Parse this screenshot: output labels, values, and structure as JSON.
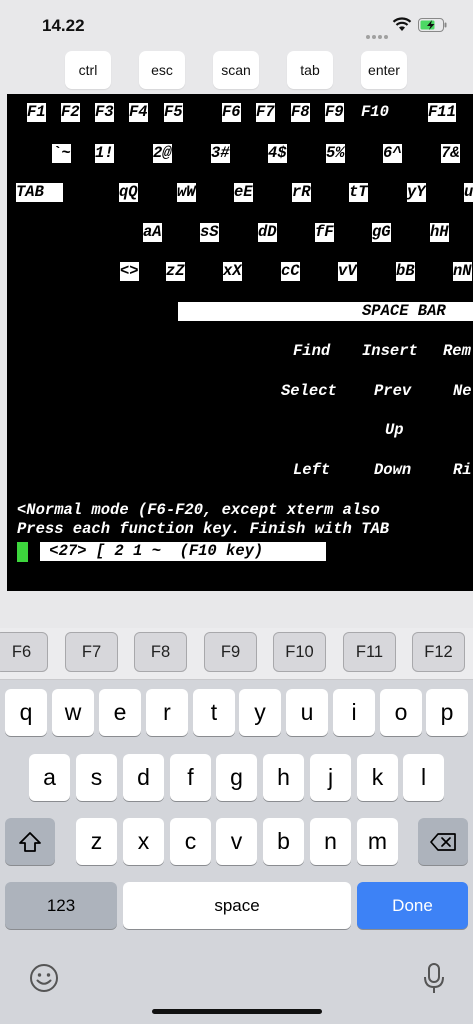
{
  "status_bar": {
    "time": "14.22"
  },
  "control_buttons": [
    "ctrl",
    "esc",
    "scan",
    "tab",
    "enter"
  ],
  "terminal": {
    "fkeys": [
      "F1",
      "F2",
      "F3",
      "F4",
      "F5",
      "F6",
      "F7",
      "F8",
      "F9",
      "F10",
      "F11"
    ],
    "num_keys": [
      "`~",
      "1!",
      "2@",
      "3#",
      "4$",
      "5%",
      "6^",
      "7&"
    ],
    "tab_row": [
      "TAB",
      "qQ",
      "wW",
      "eE",
      "rR",
      "tT",
      "yY",
      "u"
    ],
    "home_row": [
      "aA",
      "sS",
      "dD",
      "fF",
      "gG",
      "hH"
    ],
    "bottom_row": [
      "<>",
      "zZ",
      "xX",
      "cC",
      "vV",
      "bB",
      "nN"
    ],
    "space_bar": "SPACE BAR",
    "nav_row1": [
      "Find",
      "Insert",
      "Rem"
    ],
    "nav_row2": [
      "Select",
      "Prev",
      "Ne"
    ],
    "nav_up": "Up",
    "nav_row4": [
      "Left",
      "Down",
      "Ri"
    ],
    "message_line1": "<Normal mode (F6-F20, except xterm also",
    "message_line2": "Press each function key. Finish with TAB",
    "result_line": " <27> [ 2 1 ~  (F10 key)"
  },
  "keyboard": {
    "function_keys": [
      "F6",
      "F7",
      "F8",
      "F9",
      "F10",
      "F11",
      "F12"
    ],
    "row1": [
      "q",
      "w",
      "e",
      "r",
      "t",
      "y",
      "u",
      "i",
      "o",
      "p"
    ],
    "row2": [
      "a",
      "s",
      "d",
      "f",
      "g",
      "h",
      "j",
      "k",
      "l"
    ],
    "row3": [
      "z",
      "x",
      "c",
      "v",
      "b",
      "n",
      "m"
    ],
    "numbers_label": "123",
    "space_label": "space",
    "done_label": "Done",
    "shift_icon": "shift-icon",
    "delete_icon": "delete-icon",
    "emoji_icon": "emoji-icon",
    "mic_icon": "microphone-icon"
  },
  "colors": {
    "terminal_bg": "#000000",
    "cursor": "#3dd63d",
    "done_key": "#3d82f6"
  }
}
